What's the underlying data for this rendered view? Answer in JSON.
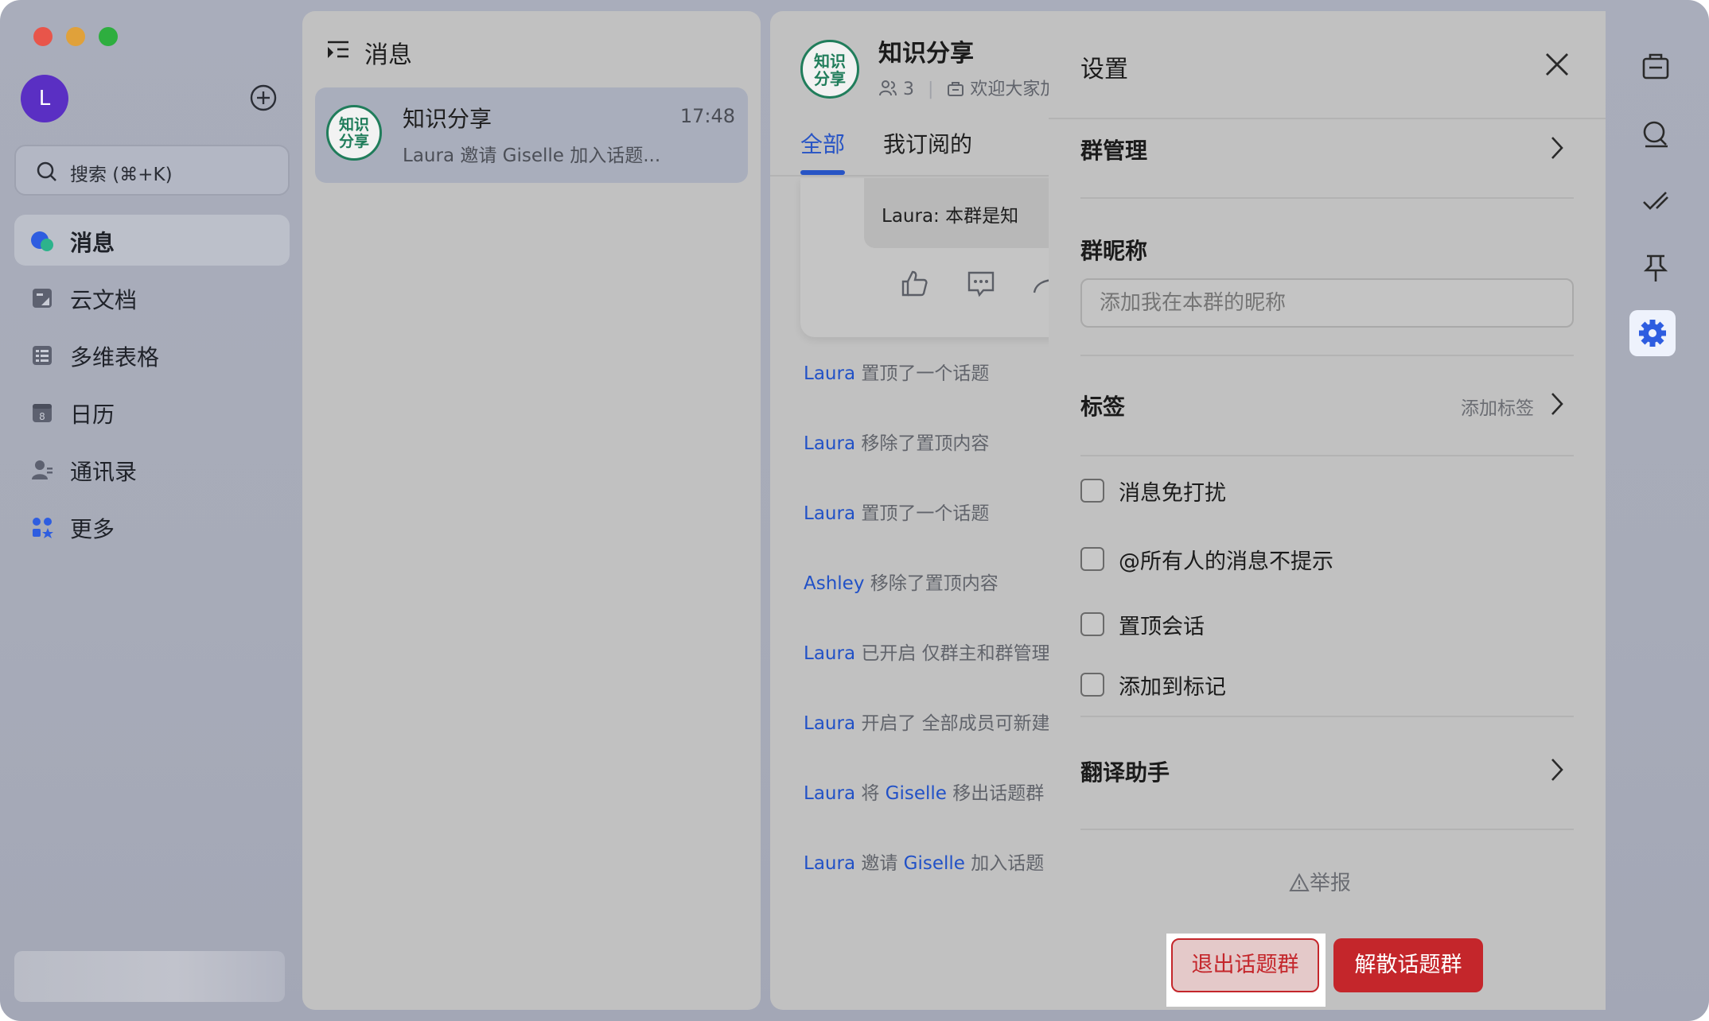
{
  "window": {
    "traffic_lights": {
      "close": "#e8554a",
      "minimize": "#e0a13a",
      "zoom": "#2eae3f"
    }
  },
  "sidebar": {
    "avatar_initial": "L",
    "search_placeholder": "搜索 (⌘+K)",
    "items": [
      {
        "label": "消息",
        "icon": "message-icon",
        "active": true
      },
      {
        "label": "云文档",
        "icon": "cloud-doc-icon",
        "active": false
      },
      {
        "label": "多维表格",
        "icon": "base-table-icon",
        "active": false
      },
      {
        "label": "日历",
        "icon": "calendar-icon",
        "active": false
      },
      {
        "label": "通讯录",
        "icon": "contacts-icon",
        "active": false
      },
      {
        "label": "更多",
        "icon": "more-apps-icon",
        "active": false
      }
    ]
  },
  "message_list": {
    "title": "消息",
    "chats": [
      {
        "avatar_text": "知识\n分享",
        "name": "知识分享",
        "time": "17:48",
        "preview": "Laura 邀请 Giselle 加入话题..."
      }
    ]
  },
  "chat": {
    "avatar_text": "知识\n分享",
    "title": "知识分享",
    "member_count": "3",
    "description": "欢迎大家加",
    "tabs": [
      {
        "label": "全部",
        "active": true
      },
      {
        "label": "我订阅的",
        "active": false
      }
    ],
    "bubble_text": "Laura: 本群是知",
    "system_messages": [
      {
        "user": "Laura",
        "text": "置顶了一个话题"
      },
      {
        "user": "Laura",
        "text": "移除了置顶内容"
      },
      {
        "user": "Laura",
        "text": "置顶了一个话题"
      },
      {
        "user": "Ashley",
        "text": "移除了置顶内容"
      },
      {
        "user": "Laura",
        "text": "已开启 仅群主和群管理"
      },
      {
        "user": "Laura",
        "text": "开启了 全部成员可新建"
      },
      {
        "user": "Laura",
        "text": "将",
        "target": "Giselle",
        "text2": "移出话题群"
      },
      {
        "user": "Laura",
        "text": "邀请",
        "target": "Giselle",
        "text2": "加入话题"
      }
    ]
  },
  "settings": {
    "title": "设置",
    "group_manage": "群管理",
    "nickname_label": "群昵称",
    "nickname_placeholder": "添加我在本群的昵称",
    "tags_label": "标签",
    "add_tag": "添加标签",
    "checkboxes": [
      {
        "label": "消息免打扰",
        "checked": false
      },
      {
        "label": "@所有人的消息不提示",
        "checked": false
      },
      {
        "label": "置顶会话",
        "checked": false
      },
      {
        "label": "添加到标记",
        "checked": false
      }
    ],
    "translate": "翻译助手",
    "report": "举报",
    "quit_button": "退出话题群",
    "disband_button": "解散话题群",
    "accent_red": "#c4262b"
  },
  "right_toolbar": {
    "icons": [
      "announcement-icon",
      "search-icon",
      "check-icon",
      "pin-icon",
      "settings-gear-icon"
    ],
    "selected": "settings-gear-icon",
    "accent": "#2e5de0"
  }
}
